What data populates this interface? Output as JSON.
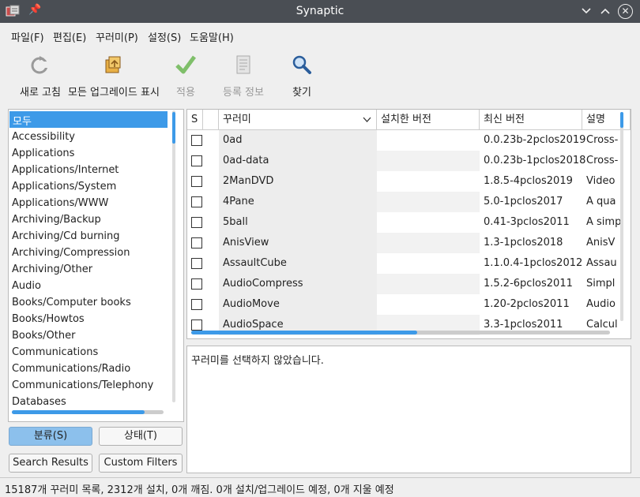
{
  "window": {
    "title": "Synaptic"
  },
  "menu": [
    "파일(F)",
    "편집(E)",
    "꾸러미(P)",
    "설정(S)",
    "도움말(H)"
  ],
  "toolbar": {
    "refresh": "새로 고침",
    "mark_all_upgrades": "모든 업그레이드 표시",
    "apply": "적용",
    "properties": "등록 정보",
    "search": "찾기"
  },
  "sections": {
    "selected": "모두",
    "items": [
      "Accessibility",
      "Applications",
      "Applications/Internet",
      "Applications/System",
      "Applications/WWW",
      "Archiving/Backup",
      "Archiving/Cd burning",
      "Archiving/Compression",
      "Archiving/Other",
      "Audio",
      "Books/Computer books",
      "Books/Howtos",
      "Books/Other",
      "Communications",
      "Communications/Radio",
      "Communications/Telephony",
      "Databases"
    ]
  },
  "filter_buttons": {
    "sections": "분류(S)",
    "status": "상태(T)",
    "search_results": "Search Results",
    "custom_filters": "Custom Filters"
  },
  "table": {
    "headers": {
      "s": "S",
      "package": "꾸러미",
      "installed": "설치한 버전",
      "latest": "최신 버전",
      "description": "설명"
    },
    "rows": [
      {
        "name": "0ad",
        "installed": "",
        "latest": "0.0.23b-2pclos2019",
        "desc": "Cross-"
      },
      {
        "name": "0ad-data",
        "installed": "",
        "latest": "0.0.23b-1pclos2018",
        "desc": "Cross-"
      },
      {
        "name": "2ManDVD",
        "installed": "",
        "latest": "1.8.5-4pclos2019",
        "desc": "Video"
      },
      {
        "name": "4Pane",
        "installed": "",
        "latest": "5.0-1pclos2017",
        "desc": "A qua"
      },
      {
        "name": "5ball",
        "installed": "",
        "latest": "0.41-3pclos2011",
        "desc": "A simp"
      },
      {
        "name": "AnisView",
        "installed": "",
        "latest": "1.3-1pclos2018",
        "desc": "AnisV"
      },
      {
        "name": "AssaultCube",
        "installed": "",
        "latest": "1.1.0.4-1pclos2012",
        "desc": "Assau"
      },
      {
        "name": "AudioCompress",
        "installed": "",
        "latest": "1.5.2-6pclos2011",
        "desc": "Simpl"
      },
      {
        "name": "AudioMove",
        "installed": "",
        "latest": "1.20-2pclos2011",
        "desc": "Audio"
      },
      {
        "name": "AudioSpace",
        "installed": "",
        "latest": "3.3-1pclos2011",
        "desc": "Calcul"
      }
    ]
  },
  "description_text": "꾸러미를 선택하지 않았습니다.",
  "status_text": "15187개 꾸러미 목록, 2312개 설치, 0개 깨짐. 0개 설치/업그레이드 예정, 0개 지울 예정"
}
